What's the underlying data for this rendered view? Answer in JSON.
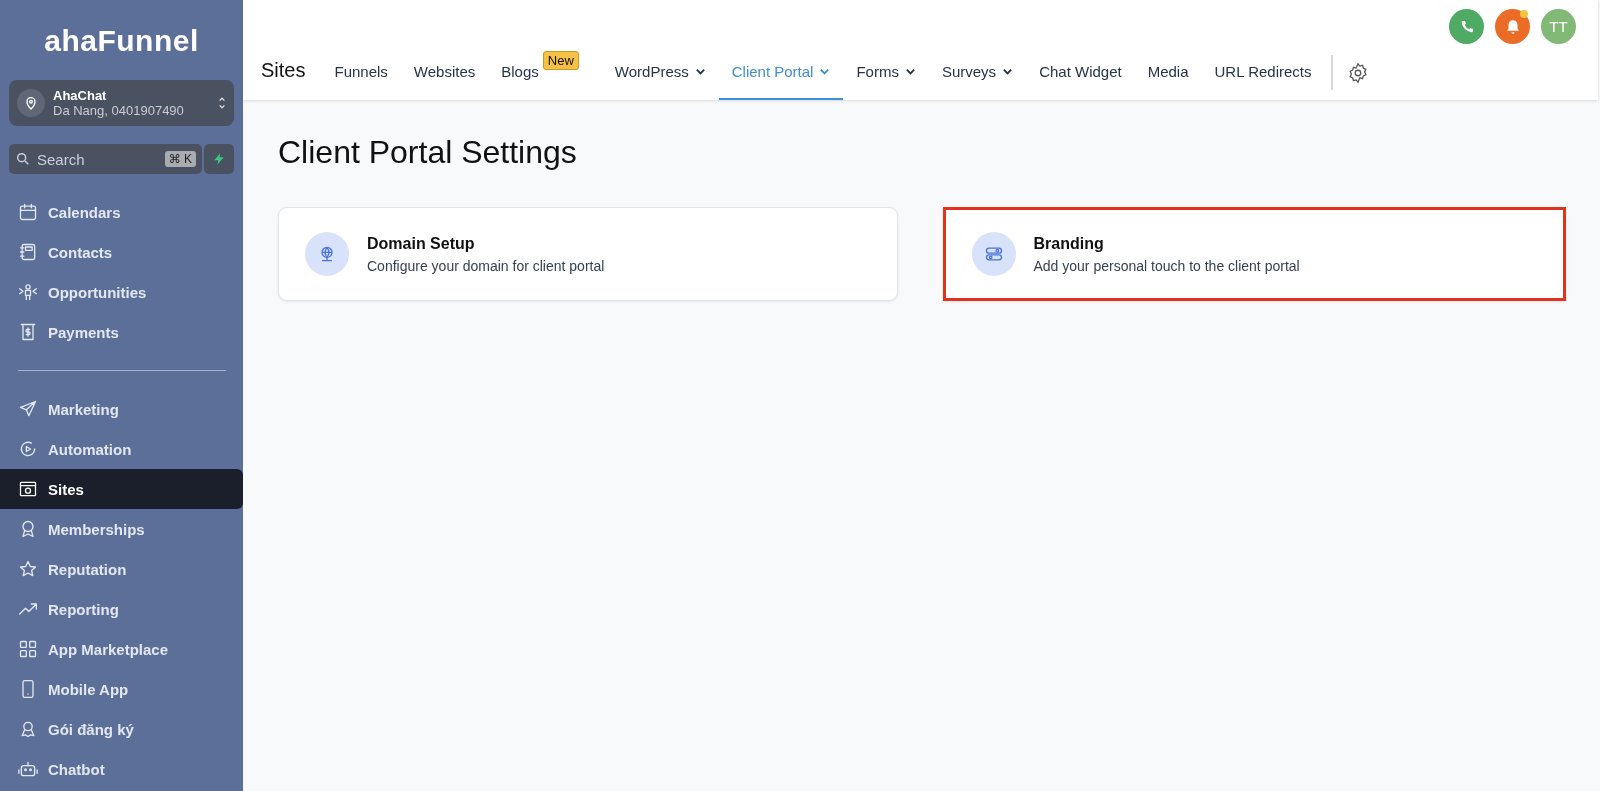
{
  "sidebar": {
    "logo": "ahaFunnel",
    "account": {
      "name": "AhaChat",
      "detail": "Da Nang, 0401907490"
    },
    "search": {
      "placeholder": "Search",
      "shortcut": "⌘ K"
    },
    "groups": [
      [
        {
          "label": "Calendars",
          "selected": false
        },
        {
          "label": "Contacts",
          "selected": false
        },
        {
          "label": "Opportunities",
          "selected": false
        },
        {
          "label": "Payments",
          "selected": false
        }
      ],
      [
        {
          "label": "Marketing",
          "selected": false
        },
        {
          "label": "Automation",
          "selected": false
        },
        {
          "label": "Sites",
          "selected": true
        },
        {
          "label": "Memberships",
          "selected": false
        },
        {
          "label": "Reputation",
          "selected": false
        },
        {
          "label": "Reporting",
          "selected": false
        },
        {
          "label": "App Marketplace",
          "selected": false
        },
        {
          "label": "Mobile App",
          "selected": false
        },
        {
          "label": "Gói đăng ký",
          "selected": false
        },
        {
          "label": "Chatbot",
          "selected": false
        }
      ]
    ]
  },
  "header": {
    "avatar": "TT",
    "notification_dot": true,
    "title": "Sites",
    "tabs": [
      {
        "label": "Funnels",
        "selected": false,
        "dropdown": false
      },
      {
        "label": "Websites",
        "selected": false,
        "dropdown": false
      },
      {
        "label": "Blogs",
        "selected": false,
        "dropdown": false,
        "badge": "New"
      },
      {
        "label": "WordPress",
        "selected": false,
        "dropdown": true
      },
      {
        "label": "Client Portal",
        "selected": true,
        "dropdown": true
      },
      {
        "label": "Forms",
        "selected": false,
        "dropdown": true
      },
      {
        "label": "Surveys",
        "selected": false,
        "dropdown": true
      },
      {
        "label": "Chat Widget",
        "selected": false,
        "dropdown": false
      },
      {
        "label": "Media",
        "selected": false,
        "dropdown": false
      },
      {
        "label": "URL Redirects",
        "selected": false,
        "dropdown": false
      }
    ]
  },
  "page": {
    "title": "Client Portal Settings",
    "cards": [
      {
        "kind": "domain",
        "title": "Domain Setup",
        "description": "Configure your domain for client portal",
        "highlighted": false
      },
      {
        "kind": "branding",
        "title": "Branding",
        "description": "Add your personal touch to the client portal",
        "highlighted": true
      }
    ]
  }
}
